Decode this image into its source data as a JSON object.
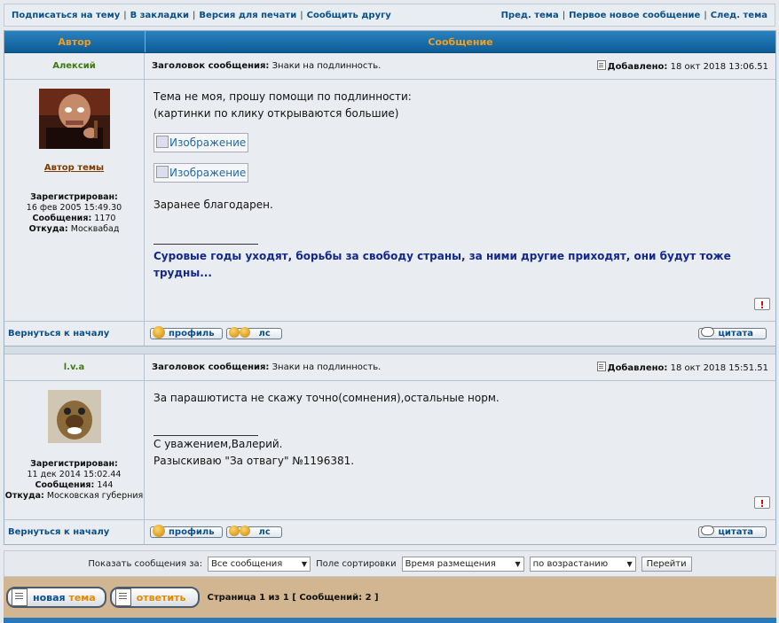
{
  "topbar": {
    "left_links": [
      "Подписаться на тему",
      "В закладки",
      "Версия для печати",
      "Сообщить другу"
    ],
    "right_links": [
      "Пред. тема",
      "Первое новое сообщение",
      "След. тема"
    ]
  },
  "header": {
    "author_col": "Автор",
    "message_col": "Сообщение"
  },
  "posts": [
    {
      "author": "Алексий",
      "subject_label": "Заголовок сообщения:",
      "subject": "Знаки на подлинность.",
      "posted_label": "Добавлено:",
      "posted": "18 окт 2018 13:06.51",
      "role": "Автор темы",
      "reg_label": "Зарегистрирован:",
      "reg_date": "16 фев 2005 15:49.30",
      "msgs_label": "Сообщения:",
      "msgs": "1170",
      "from_label": "Откуда:",
      "from": "Москвабад",
      "text1": "Тема не моя, прошу помощи по подлинности:",
      "text2": "(картинки по клику открываются большие)",
      "img1": "Изображение",
      "img2": "Изображение",
      "text3": "Заранее благодарен.",
      "signature": "Суровые годы уходят, борьбы за свободу страны, за ними другие приходят, они будут тоже трудны..."
    },
    {
      "author": "l.v.a",
      "subject_label": "Заголовок сообщения:",
      "subject": "Знаки на подлинность.",
      "posted_label": "Добавлено:",
      "posted": "18 окт 2018 15:51.51",
      "reg_label": "Зарегистрирован:",
      "reg_date": "11 дек 2014 15:02.44",
      "msgs_label": "Сообщения:",
      "msgs": "144",
      "from_label": "Откуда:",
      "from": "Московская губерния",
      "text1": "За парашютиста не скажу точно(сомнения),остальные норм.",
      "sig1": "С уважением,Валерий.",
      "sig2": "Разыскиваю \"За отвагу\" №1196381."
    }
  ],
  "footer": {
    "back_to_top": "Вернуться к началу",
    "profile_btn": "профиль",
    "pm_btn": "лс",
    "quote_btn": "цитата"
  },
  "sortbar": {
    "show_label": "Показать сообщения за:",
    "show_value": "Все сообщения",
    "sort_label": "Поле сортировки",
    "sort_value": "Время размещения",
    "order_value": "по возрастанию",
    "go_btn": "Перейти"
  },
  "bottom": {
    "new_topic_1": "новая",
    "new_topic_2": "тема",
    "reply": "ответить",
    "pager": "Страница 1 из 1 [ Сообщений: 2 ]"
  },
  "colors": {
    "header_bg": "#0d5c97",
    "header_text": "#f0a020",
    "author_name": "#3e7a10",
    "link": "#0a4f87",
    "bottom_bar": "#d2b692"
  },
  "icons": [
    "posted-icon",
    "report-icon",
    "profile-icon",
    "pm-icon",
    "quote-icon",
    "document-icon",
    "dropdown-arrow-icon"
  ]
}
